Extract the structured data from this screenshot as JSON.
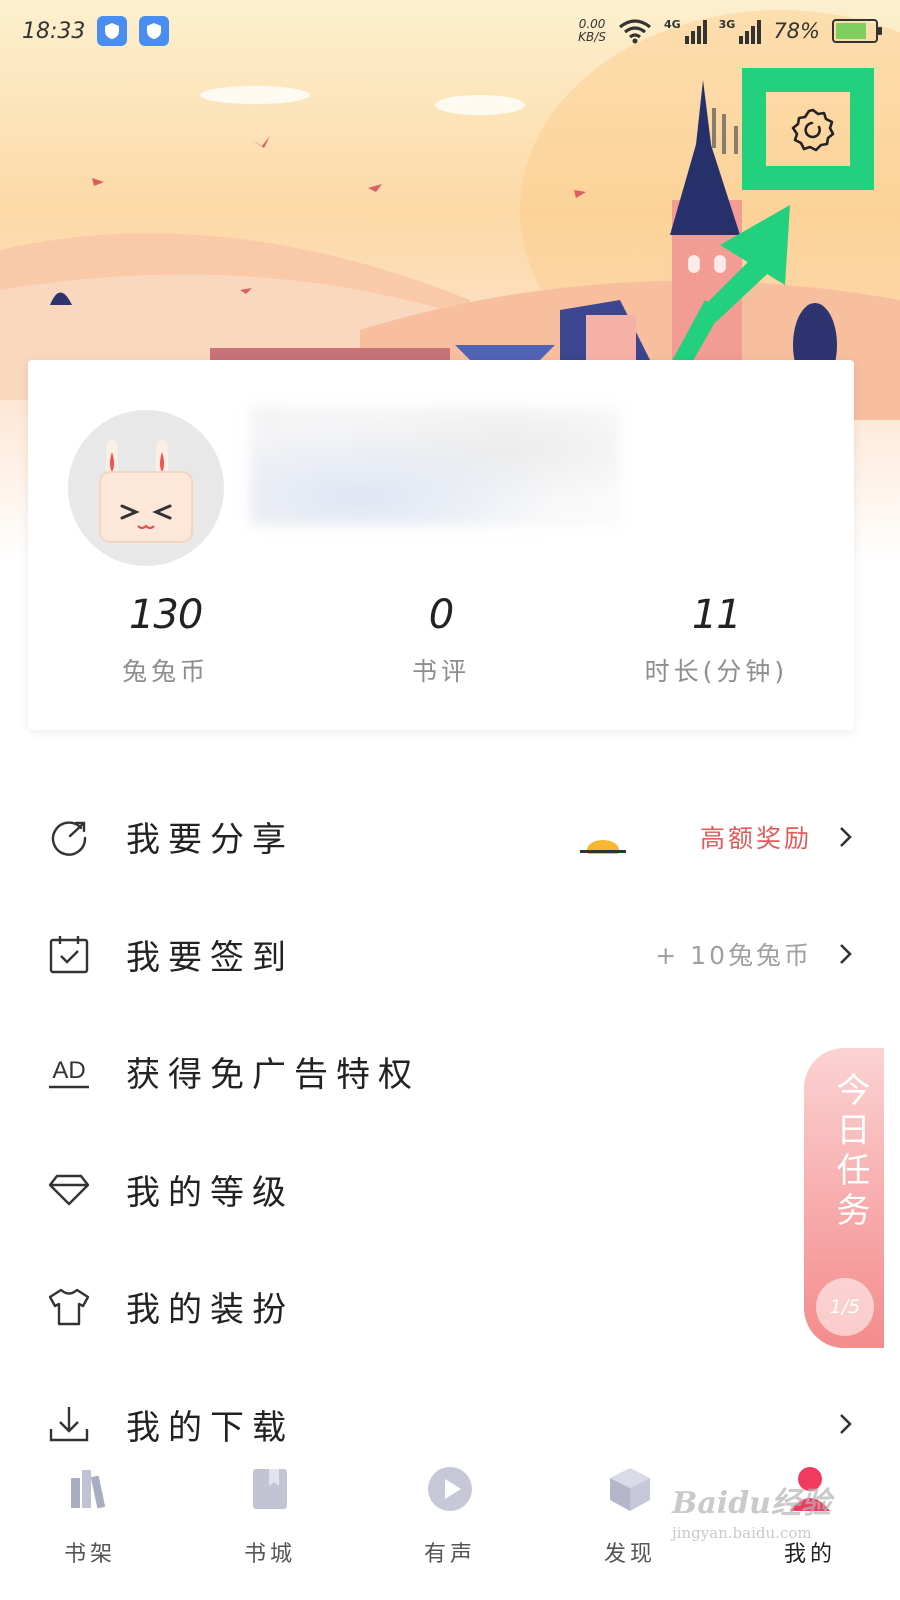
{
  "status_bar": {
    "time": "18:33",
    "net_speed_value": "0.00",
    "net_speed_unit": "KB/S",
    "signal_1_label": "4G",
    "signal_2_label": "3G",
    "battery_percent": "78%",
    "battery_level": 0.78
  },
  "header": {
    "settings_icon": "gear-icon"
  },
  "profile": {
    "avatar_icon": "bunny-avatar",
    "stats": [
      {
        "value": "130",
        "label": "兔兔币"
      },
      {
        "value": "0",
        "label": "书评"
      },
      {
        "value": "11",
        "label": "时长(分钟)"
      }
    ]
  },
  "menu": {
    "items": [
      {
        "label": "我要分享",
        "icon": "share-icon",
        "extra": "高额奖励"
      },
      {
        "label": "我要签到",
        "icon": "calendar-check-icon",
        "extra": "+ 10兔兔币"
      },
      {
        "label": "获得免广告特权",
        "icon": "ad-icon"
      },
      {
        "label": "我的等级",
        "icon": "diamond-icon"
      },
      {
        "label": "我的装扮",
        "icon": "tshirt-icon"
      },
      {
        "label": "我的下载",
        "icon": "download-icon"
      }
    ]
  },
  "daily_task": {
    "title": "今日任务",
    "progress": "1/5"
  },
  "bottom_nav": {
    "items": [
      {
        "label": "书架",
        "icon": "bookshelf-icon"
      },
      {
        "label": "书城",
        "icon": "bookstore-icon"
      },
      {
        "label": "有声",
        "icon": "audio-play-icon"
      },
      {
        "label": "发现",
        "icon": "discover-cube-icon"
      },
      {
        "label": "我的",
        "icon": "profile-icon"
      }
    ],
    "active_index": 4
  },
  "watermark": {
    "main": "Baidu经验",
    "sub": "jingyan.baidu.com"
  },
  "colors": {
    "highlight": "#22d07e",
    "accent_red": "#e35a5a",
    "task_pink": "#f7a6a6"
  }
}
